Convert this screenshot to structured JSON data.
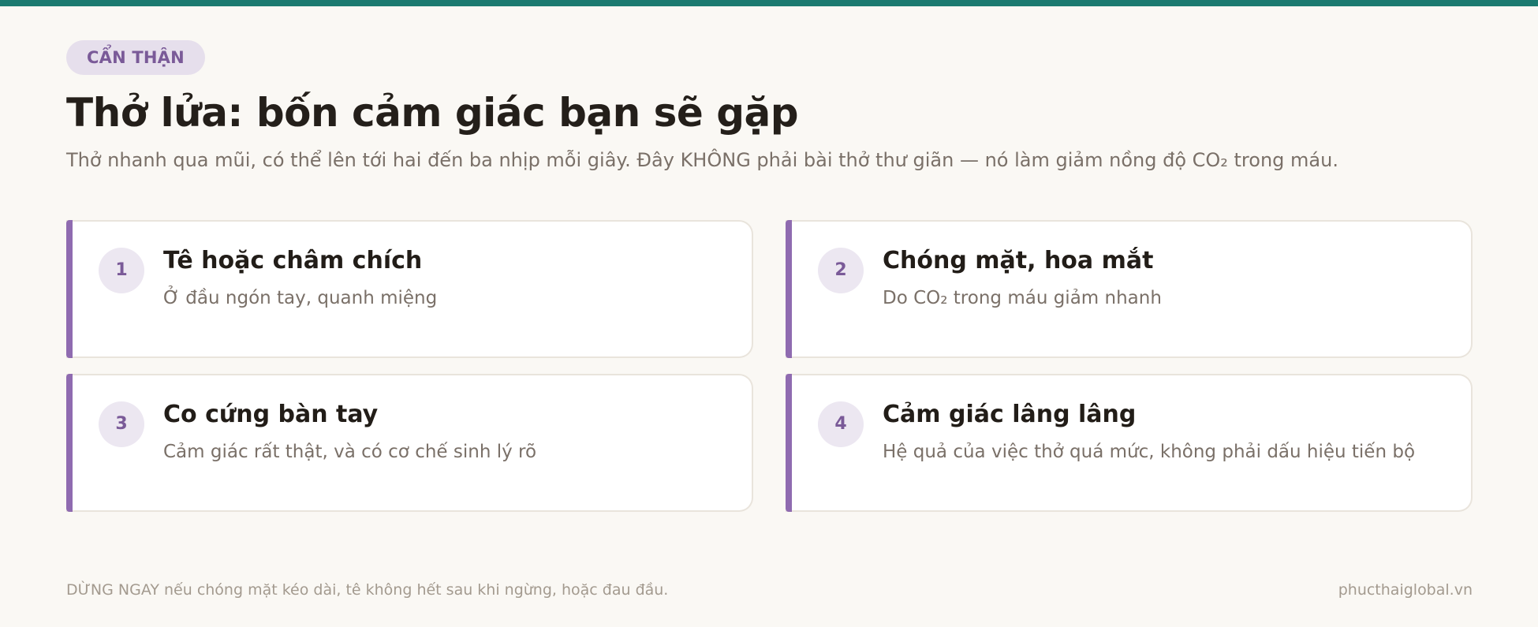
{
  "badge": "CẨN THẬN",
  "title": "Thở lửa: bốn cảm giác bạn sẽ gặp",
  "subtitle": "Thở nhanh qua mũi, có thể lên tới hai đến ba nhịp mỗi giây. Đây KHÔNG phải bài thở thư giãn — nó làm giảm nồng độ CO₂ trong máu.",
  "cards": [
    {
      "number": "1",
      "title": "Tê hoặc châm chích",
      "description": "Ở đầu ngón tay, quanh miệng"
    },
    {
      "number": "2",
      "title": "Chóng mặt, hoa mắt",
      "description": "Do CO₂ trong máu giảm nhanh"
    },
    {
      "number": "3",
      "title": "Co cứng bàn tay",
      "description": "Cảm giác rất thật, và có cơ chế sinh lý rõ"
    },
    {
      "number": "4",
      "title": "Cảm giác lâng lâng",
      "description": "Hệ quả của việc thở quá mức, không phải dấu hiệu tiến bộ"
    }
  ],
  "footer": {
    "warning": "DỪNG NGAY nếu chóng mặt kéo dài, tê không hết sau khi ngừng, hoặc đau đầu.",
    "site": "phucthaiglobal.vn"
  },
  "colors": {
    "top_bar": "#1b7a70",
    "accent": "#8f6bb0",
    "badge_bg": "#e6dfec",
    "background": "#faf8f4"
  }
}
